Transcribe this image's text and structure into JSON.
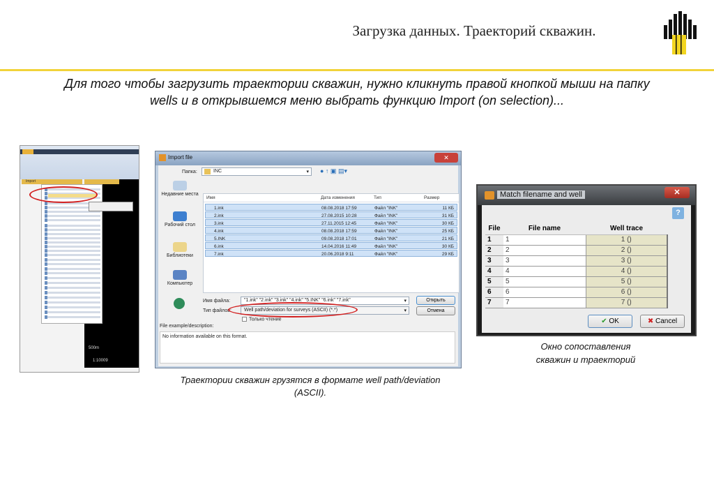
{
  "slide": {
    "title": "Загрузка данных. Траекторий скважин.",
    "intro_line1": "Для того чтобы загрузить траектории скважин, нужно кликнуть правой кнопкой мыши на папку",
    "intro_line2": "wells и в открывшемся меню выбрать функцию Import (on selection)...",
    "caption_import": "Траектории скважин грузятся в формате well path/deviation (ASCII).",
    "caption_match_line1": "Окно сопоставления",
    "caption_match_line2": "скважин и траекторий",
    "accent_color": "#f2d33a"
  },
  "app_screenshot": {
    "panel_title": "Import",
    "scale_bar": "500m",
    "scale_ratio": "1:10009"
  },
  "import_dialog": {
    "title": "Import file",
    "folder_label": "Папка:",
    "folder_value": "INC",
    "columns": [
      "Имя",
      "Дата изменения",
      "Тип",
      "Размер"
    ],
    "files": [
      {
        "name": "1.ink",
        "date": "08.08.2018 17:59",
        "type": "Файл \"INK\"",
        "size": "11 КБ"
      },
      {
        "name": "2.ink",
        "date": "27.08.2015 10:28",
        "type": "Файл \"INK\"",
        "size": "31 КБ"
      },
      {
        "name": "3.ink",
        "date": "27.11.2015 12:45",
        "type": "Файл \"INK\"",
        "size": "30 КБ"
      },
      {
        "name": "4.ink",
        "date": "08.08.2018 17:59",
        "type": "Файл \"INK\"",
        "size": "25 КБ"
      },
      {
        "name": "5.INK",
        "date": "09.08.2018 17:01",
        "type": "Файл \"INK\"",
        "size": "21 КБ"
      },
      {
        "name": "6.ink",
        "date": "14.04.2016 11:49",
        "type": "Файл \"INK\"",
        "size": "30 КБ"
      },
      {
        "name": "7.ink",
        "date": "20.06.2018 9:11",
        "type": "Файл \"INK\"",
        "size": "29 КБ"
      }
    ],
    "places": [
      "Недавние места",
      "Рабочий стол",
      "Библиотеки",
      "Компьютер"
    ],
    "filename_label": "Имя файла:",
    "filename_value": "\"1.ink\" \"2.ink\" \"3.ink\" \"4.ink\" \"5.INK\" \"6.ink\" \"7.ink\"",
    "filetype_label": "Тип файлов:",
    "filetype_value": "Well path/deviation for surveys (ASCII) (*.*)",
    "readonly_label": "Только чтение",
    "open_button": "Открыть",
    "cancel_button": "Отмена",
    "description_label": "File example/description:",
    "description_text": "No information available on this format."
  },
  "match_dialog": {
    "title": "Match filename and well",
    "help": "?",
    "columns": [
      "File",
      "File name",
      "Well trace"
    ],
    "rows": [
      {
        "file": "1",
        "name": "1",
        "trace": "1 ()"
      },
      {
        "file": "2",
        "name": "2",
        "trace": "2 ()"
      },
      {
        "file": "3",
        "name": "3",
        "trace": "3 ()"
      },
      {
        "file": "4",
        "name": "4",
        "trace": "4 ()"
      },
      {
        "file": "5",
        "name": "5",
        "trace": "5 ()"
      },
      {
        "file": "6",
        "name": "6",
        "trace": "6 ()"
      },
      {
        "file": "7",
        "name": "7",
        "trace": "7 ()"
      }
    ],
    "ok_button": "OK",
    "cancel_button": "Cancel"
  }
}
